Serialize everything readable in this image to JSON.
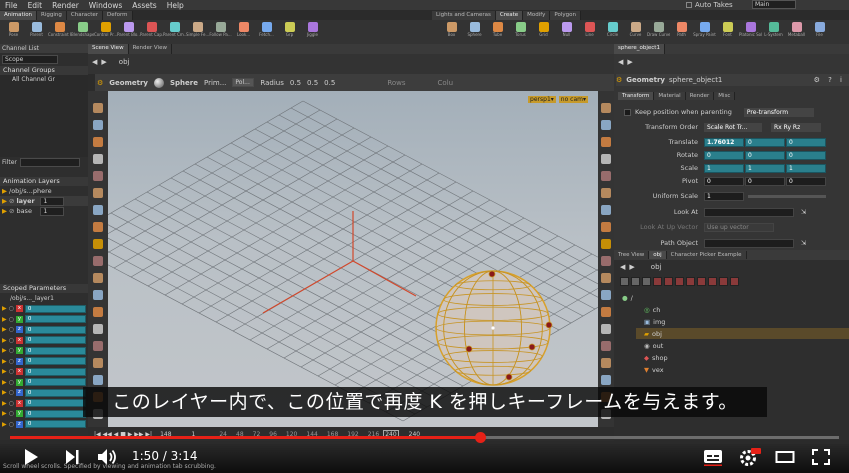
{
  "menu": [
    "File",
    "Edit",
    "Render",
    "Windows",
    "Assets",
    "Help"
  ],
  "top_right": {
    "auto_takes": "Auto Takes",
    "desktop": "Main"
  },
  "shelf_tabs_left": [
    "Animation",
    "Rigging",
    "Character",
    "Deform"
  ],
  "shelf_tabs_right": [
    "Lights and Cameras",
    "Create",
    "Modify",
    "Polygon"
  ],
  "shelf_tools_left": [
    "Pose",
    "Parent",
    "Constraint Fo...",
    "Blendshapes",
    "Control Pr...",
    "Parent Blo...",
    "Parent Cap...",
    "Parent Cm...",
    "Simple Fe...",
    "Follow Pa...",
    "Look...",
    "Fetch...",
    "Grp",
    "Jiggle"
  ],
  "shelf_tools_right": [
    "Box",
    "Sphere",
    "Tube",
    "Torus",
    "Grid",
    "Null",
    "Line",
    "Circle",
    "Curve",
    "Draw Curve",
    "Path",
    "Spray Paint",
    "Font",
    "Platonic Sol...",
    "L-System",
    "Metaball",
    "File"
  ],
  "left_panel": {
    "tabs": [
      "Channel List",
      "Scene View",
      "Render View"
    ],
    "scope_label": "Scope",
    "channel_groups_header": "Channel Groups",
    "channel_group_item": "All Channel Gr",
    "filter_label": "Filter",
    "animation_layers_header": "Animation Layers",
    "layer_path": "/obj/s...phere",
    "layers": [
      {
        "name": "layer",
        "value": "1"
      },
      {
        "name": "base",
        "value": "1"
      }
    ],
    "scoped_parameters_header": "Scoped Parameters",
    "scoped_path": "/obj/s..._layer1",
    "params": [
      {
        "chan": "x",
        "value": "0"
      },
      {
        "chan": "y",
        "value": "0"
      },
      {
        "chan": "z",
        "value": "0"
      },
      {
        "chan": "x",
        "value": "0"
      },
      {
        "chan": "y",
        "value": "0"
      },
      {
        "chan": "z",
        "value": "0"
      },
      {
        "chan": "x",
        "value": "0"
      },
      {
        "chan": "y",
        "value": "0"
      },
      {
        "chan": "z",
        "value": "0"
      },
      {
        "chan": "x",
        "value": "0"
      },
      {
        "chan": "y",
        "value": "0"
      },
      {
        "chan": "z",
        "value": "0"
      }
    ]
  },
  "viewport": {
    "tabs": [
      "Scene View",
      "Render View"
    ],
    "path": "obj",
    "context": "Geometry",
    "prim_label": "Sphere",
    "prim_type": "Prim...",
    "poly": "Pol...",
    "radius_label": "Radius",
    "radius": [
      "0.5",
      "0.5",
      "0.5"
    ],
    "rows_label": "Rows",
    "cols_label": "Colu",
    "persp": "persp1▾",
    "nocam": "no cam▾"
  },
  "timeline": {
    "start": "1",
    "end": "240",
    "frame": "148",
    "ticks": [
      "24",
      "48",
      "72",
      "96",
      "120",
      "144",
      "168",
      "192",
      "216"
    ],
    "end2": "240"
  },
  "param_panel": {
    "tab": "sphere_object1",
    "type": "Geometry",
    "name": "sphere_object1",
    "subtabs": [
      "Transform",
      "Material",
      "Render",
      "Misc"
    ],
    "keep_position": "Keep position when parenting",
    "pretransform": "Pre-transform",
    "transform_order_label": "Transform Order",
    "transform_order": "Scale Rot Tr...",
    "rot_order": "Rx Ry Rz",
    "translate_label": "Translate",
    "translate": [
      "1.76012",
      "0",
      "0"
    ],
    "rotate_label": "Rotate",
    "rotate": [
      "0",
      "0",
      "0"
    ],
    "scale_label": "Scale",
    "scale": [
      "1",
      "1",
      "1"
    ],
    "pivot_label": "Pivot",
    "pivot": [
      "0",
      "0",
      "0"
    ],
    "uniform_scale_label": "Uniform Scale",
    "uniform_scale": "1",
    "look_at_label": "Look At",
    "look_up_label": "Look At Up Vector",
    "look_up_value": "Use up vector",
    "path_object_label": "Path Object"
  },
  "tree_panel": {
    "tabs": [
      "Tree View",
      "obj",
      "Character Picker Example"
    ],
    "path": "obj",
    "root": "/",
    "nodes": [
      "ch",
      "img",
      "obj",
      "out",
      "shop",
      "vex"
    ]
  },
  "subtitle": "このレイヤー内で、この位置で再度 K を押しキーフレームを与えます。",
  "player": {
    "time": "1:50 / 3:14",
    "progress": 0.567
  },
  "status": "Scroll wheel scrolls. Specified by viewing and animation tab scrubbing."
}
